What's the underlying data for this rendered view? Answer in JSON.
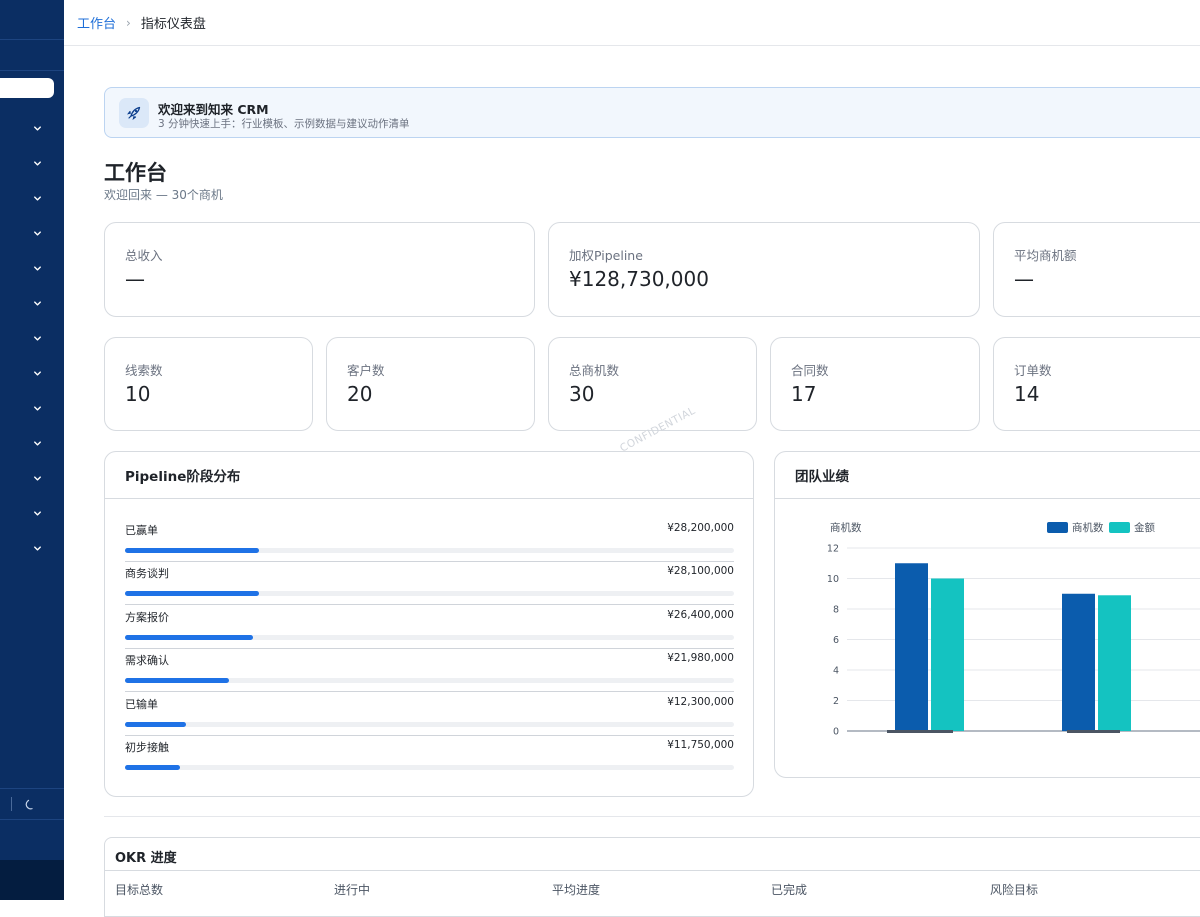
{
  "breadcrumb": {
    "root": "工作台",
    "current": "指标仪表盘"
  },
  "banner": {
    "title": "欢迎来到知来 CRM",
    "subtitle": "3 分钟快速上手：行业模板、示例数据与建议动作清单"
  },
  "page": {
    "title": "工作台",
    "subtitle": "欢迎回来 — 30个商机"
  },
  "kpi_top": [
    {
      "label": "总收入",
      "value": "—"
    },
    {
      "label": "加权Pipeline",
      "value": "¥128,730,000"
    },
    {
      "label": "平均商机额",
      "value": "—"
    }
  ],
  "kpi_counts": [
    {
      "label": "线索数",
      "value": "10"
    },
    {
      "label": "客户数",
      "value": "20"
    },
    {
      "label": "总商机数",
      "value": "30"
    },
    {
      "label": "合同数",
      "value": "17"
    },
    {
      "label": "订单数",
      "value": "14"
    }
  ],
  "pipeline": {
    "title": "Pipeline阶段分布",
    "watermark": "CONFIDENTIAL",
    "stages": [
      {
        "name": "已赢单",
        "amount": "¥28,200,000",
        "share": 0.22
      },
      {
        "name": "商务谈判",
        "amount": "¥28,100,000",
        "share": 0.22
      },
      {
        "name": "方案报价",
        "amount": "¥26,400,000",
        "share": 0.21
      },
      {
        "name": "需求确认",
        "amount": "¥21,980,000",
        "share": 0.17
      },
      {
        "name": "已输单",
        "amount": "¥12,300,000",
        "share": 0.1
      },
      {
        "name": "初步接触",
        "amount": "¥11,750,000",
        "share": 0.09
      }
    ]
  },
  "team": {
    "title": "团队业绩",
    "colors": {
      "count": "#0b5cad",
      "amount": "#14c3c1"
    }
  },
  "chart_data": {
    "type": "bar",
    "ylabel": "商机数",
    "ylim": [
      0,
      12
    ],
    "yticks": [
      0,
      2,
      4,
      6,
      8,
      10,
      12
    ],
    "grid": true,
    "legend_position": "top-right",
    "categories": [
      "",
      ""
    ],
    "series": [
      {
        "name": "商机数",
        "values": [
          11,
          9
        ]
      },
      {
        "name": "金额",
        "values": [
          10,
          8.9
        ]
      }
    ]
  },
  "okr": {
    "title": "OKR 进度",
    "columns": [
      "目标总数",
      "进行中",
      "平均进度",
      "已完成",
      "风险目标"
    ]
  }
}
